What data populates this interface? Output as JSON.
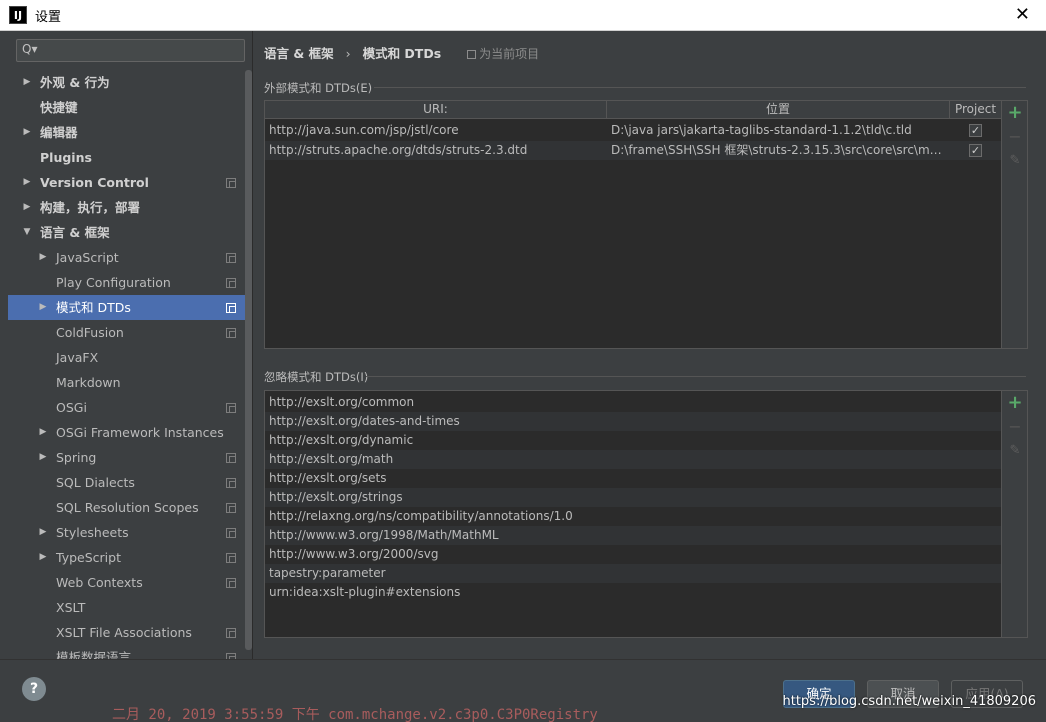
{
  "window": {
    "title": "设置",
    "app_icon": "IJ"
  },
  "search": {
    "placeholder": "Q▾"
  },
  "sidebar": {
    "items": [
      {
        "label": "外观 & 行为",
        "level": 0,
        "arrow": "right",
        "bold": true,
        "copy": false
      },
      {
        "label": "快捷键",
        "level": 0,
        "arrow": "",
        "bold": true,
        "copy": false
      },
      {
        "label": "编辑器",
        "level": 0,
        "arrow": "right",
        "bold": true,
        "copy": false
      },
      {
        "label": "Plugins",
        "level": 0,
        "arrow": "",
        "bold": true,
        "copy": false
      },
      {
        "label": "Version Control",
        "level": 0,
        "arrow": "right",
        "bold": true,
        "copy": true
      },
      {
        "label": "构建，执行，部署",
        "level": 0,
        "arrow": "right",
        "bold": true,
        "copy": false
      },
      {
        "label": "语言 & 框架",
        "level": 0,
        "arrow": "down",
        "bold": true,
        "copy": false
      },
      {
        "label": "JavaScript",
        "level": 1,
        "arrow": "right",
        "bold": false,
        "copy": true
      },
      {
        "label": "Play Configuration",
        "level": 1,
        "arrow": "",
        "bold": false,
        "copy": true
      },
      {
        "label": "模式和 DTDs",
        "level": 1,
        "arrow": "right",
        "bold": false,
        "copy": true,
        "selected": true
      },
      {
        "label": "ColdFusion",
        "level": 1,
        "arrow": "",
        "bold": false,
        "copy": true
      },
      {
        "label": "JavaFX",
        "level": 1,
        "arrow": "",
        "bold": false,
        "copy": false
      },
      {
        "label": "Markdown",
        "level": 1,
        "arrow": "",
        "bold": false,
        "copy": false
      },
      {
        "label": "OSGi",
        "level": 1,
        "arrow": "",
        "bold": false,
        "copy": true
      },
      {
        "label": "OSGi Framework Instances",
        "level": 1,
        "arrow": "right",
        "bold": false,
        "copy": false
      },
      {
        "label": "Spring",
        "level": 1,
        "arrow": "right",
        "bold": false,
        "copy": true
      },
      {
        "label": "SQL Dialects",
        "level": 1,
        "arrow": "",
        "bold": false,
        "copy": true
      },
      {
        "label": "SQL Resolution Scopes",
        "level": 1,
        "arrow": "",
        "bold": false,
        "copy": true
      },
      {
        "label": "Stylesheets",
        "level": 1,
        "arrow": "right",
        "bold": false,
        "copy": true
      },
      {
        "label": "TypeScript",
        "level": 1,
        "arrow": "right",
        "bold": false,
        "copy": true
      },
      {
        "label": "Web Contexts",
        "level": 1,
        "arrow": "",
        "bold": false,
        "copy": true
      },
      {
        "label": "XSLT",
        "level": 1,
        "arrow": "",
        "bold": false,
        "copy": false
      },
      {
        "label": "XSLT File Associations",
        "level": 1,
        "arrow": "",
        "bold": false,
        "copy": true
      },
      {
        "label": "模板数据语言",
        "level": 1,
        "arrow": "",
        "bold": false,
        "copy": true
      }
    ]
  },
  "breadcrumb": {
    "parent": "语言 & 框架",
    "separator": "›",
    "current": "模式和 DTDs",
    "scope": "为当前项目"
  },
  "external": {
    "title": "外部模式和 DTDs(E)",
    "columns": [
      "URI:",
      "位置",
      "Project"
    ],
    "rows": [
      {
        "uri": "http://java.sun.com/jsp/jstl/core",
        "location": "D:\\java jars\\jakarta-taglibs-standard-1.1.2\\tld\\c.tld",
        "project": true
      },
      {
        "uri": "http://struts.apache.org/dtds/struts-2.3.dtd",
        "location": "D:\\frame\\SSH\\SSH 框架\\struts-2.3.15.3\\src\\core\\src\\mai...",
        "project": true
      }
    ]
  },
  "ignored": {
    "title": "忽略模式和 DTDs(I)",
    "rows": [
      "http://exslt.org/common",
      "http://exslt.org/dates-and-times",
      "http://exslt.org/dynamic",
      "http://exslt.org/math",
      "http://exslt.org/sets",
      "http://exslt.org/strings",
      "http://relaxng.org/ns/compatibility/annotations/1.0",
      "http://www.w3.org/1998/Math/MathML",
      "http://www.w3.org/2000/svg",
      "tapestry:parameter",
      "urn:idea:xslt-plugin#extensions"
    ]
  },
  "toolbar": {
    "add": "+",
    "remove": "−",
    "edit": "✎"
  },
  "buttons": {
    "ok": "确定",
    "cancel": "取消",
    "apply": "应用(A)",
    "help": "?"
  },
  "watermark": "https://blog.csdn.net/weixin_41809206",
  "background_text": "二月 20, 2019 3:55:59 下午 com.mchange.v2.c3p0.C3P0Registry",
  "colors": {
    "selection": "#4b6eaf",
    "add_icon": "#59a869",
    "ok_button": "#365880"
  }
}
